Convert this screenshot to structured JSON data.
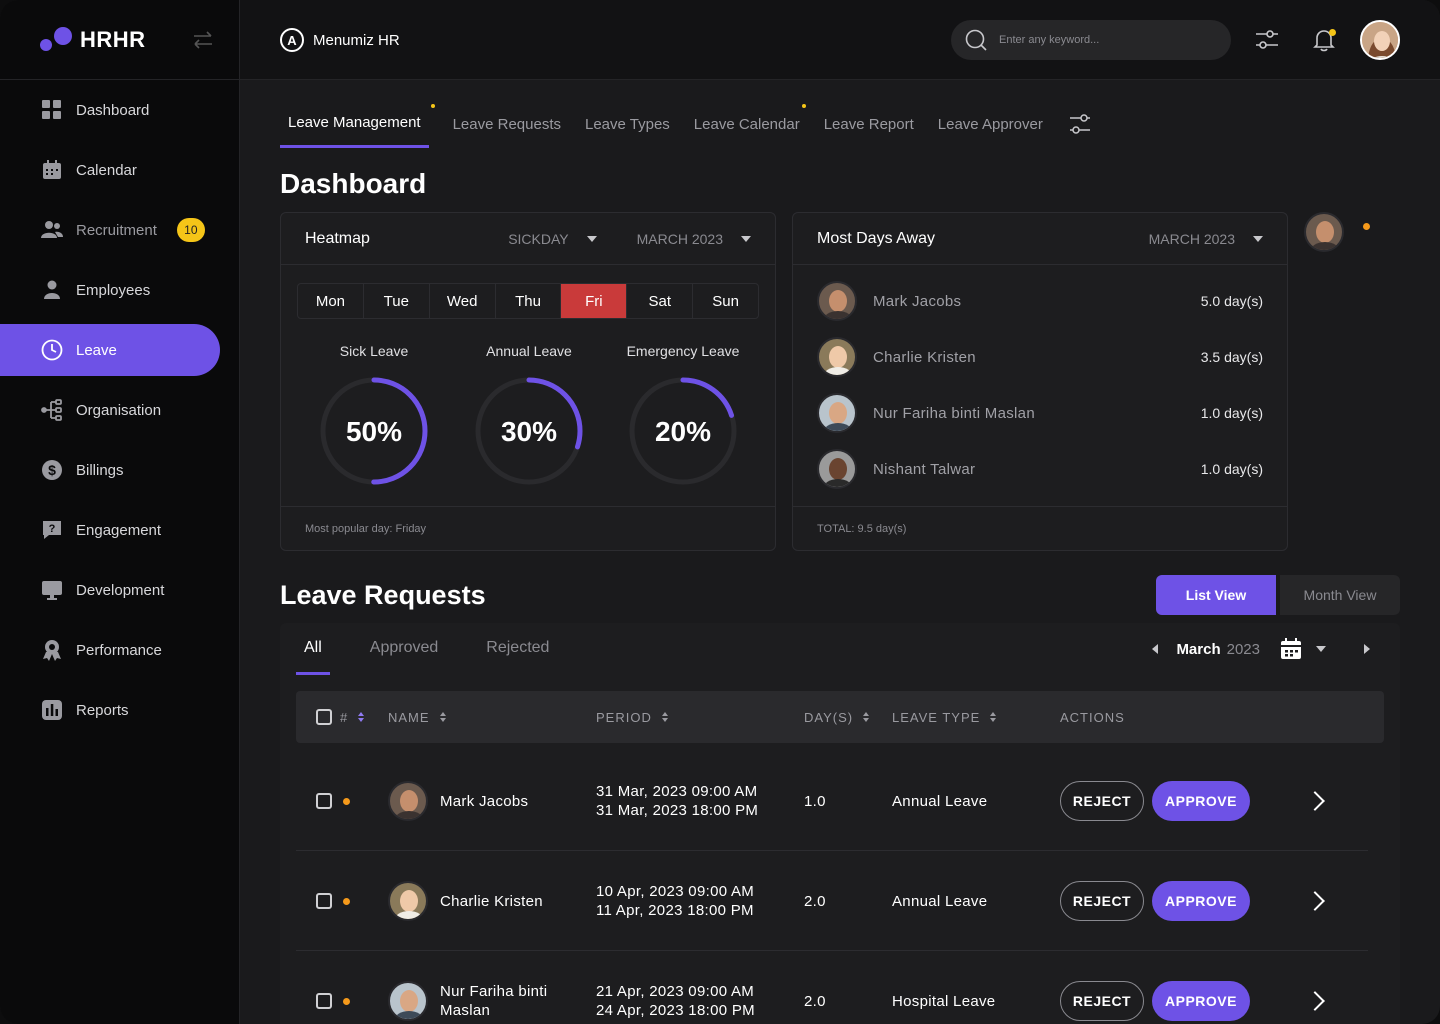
{
  "brand": {
    "name": "HRHR"
  },
  "sidebar": {
    "items": [
      {
        "label": "Dashboard",
        "icon": "grid-icon"
      },
      {
        "label": "Calendar",
        "icon": "calendar-icon"
      },
      {
        "label": "Recruitment",
        "icon": "users-icon",
        "badge": "10"
      },
      {
        "label": "Employees",
        "icon": "user-icon"
      },
      {
        "label": "Leave",
        "icon": "clock-icon",
        "active": true
      },
      {
        "label": "Organisation",
        "icon": "org-icon"
      },
      {
        "label": "Billings",
        "icon": "dollar-icon"
      },
      {
        "label": "Engagement",
        "icon": "chat-icon"
      },
      {
        "label": "Development",
        "icon": "monitor-icon"
      },
      {
        "label": "Performance",
        "icon": "award-icon"
      },
      {
        "label": "Reports",
        "icon": "chart-icon"
      }
    ]
  },
  "topbar": {
    "company_logo": "A",
    "company": "Menumiz HR",
    "search_placeholder": "Enter any keyword..."
  },
  "tabs": [
    {
      "label": "Leave Management",
      "active": true,
      "dot": true
    },
    {
      "label": "Leave Requests"
    },
    {
      "label": "Leave Types"
    },
    {
      "label": "Leave Calendar",
      "dot": true
    },
    {
      "label": "Leave Report"
    },
    {
      "label": "Leave Approver"
    }
  ],
  "page_title": "Dashboard",
  "heatmap": {
    "title": "Heatmap",
    "filter": "SICKDAY",
    "month": "MARCH 2023",
    "days": [
      "Mon",
      "Tue",
      "Wed",
      "Thu",
      "Fri",
      "Sat",
      "Sun"
    ],
    "selected_day": "Fri",
    "donuts": [
      {
        "label": "Sick Leave",
        "percent": 50,
        "text": "50%"
      },
      {
        "label": "Annual Leave",
        "percent": 30,
        "text": "30%"
      },
      {
        "label": "Emergency Leave",
        "percent": 20,
        "text": "20%"
      }
    ],
    "footer": "Most popular day: Friday"
  },
  "most_days_away": {
    "title": "Most Days Away",
    "month": "MARCH 2023",
    "rows": [
      {
        "name": "Mark Jacobs",
        "days": "5.0 day(s)"
      },
      {
        "name": "Charlie Kristen",
        "days": "3.5 day(s)"
      },
      {
        "name": "Nur Fariha binti Maslan",
        "days": "1.0 day(s)"
      },
      {
        "name": "Nishant Talwar",
        "days": "1.0 day(s)"
      }
    ],
    "footer": "TOTAL: 9.5 day(s)"
  },
  "leave_requests": {
    "title": "Leave Requests",
    "view_list": "List View",
    "view_month": "Month View",
    "filters": [
      "All",
      "Approved",
      "Rejected"
    ],
    "month": "March",
    "year": "2023",
    "headers": {
      "num": "#",
      "name": "NAME",
      "period": "PERIOD",
      "days": "DAY(S)",
      "type": "LEAVE TYPE",
      "actions": "ACTIONS"
    },
    "reject_label": "REJECT",
    "approve_label": "APPROVE",
    "rows": [
      {
        "name": "Mark Jacobs",
        "start": "31 Mar, 2023 09:00 AM",
        "end": "31 Mar, 2023 18:00 PM",
        "days": "1.0",
        "type": "Annual Leave"
      },
      {
        "name": "Charlie Kristen",
        "start": "10 Apr, 2023 09:00 AM",
        "end": "11 Apr, 2023 18:00 PM",
        "days": "2.0",
        "type": "Annual Leave"
      },
      {
        "name": "Nur Fariha binti Maslan",
        "start": "21 Apr, 2023 09:00 AM",
        "end": "24 Apr, 2023 18:00 PM",
        "days": "2.0",
        "type": "Hospital Leave"
      }
    ]
  },
  "colors": {
    "accent": "#6e52e6",
    "highlight_day": "#c93a3a",
    "badge": "#f5c518",
    "status_dot": "#f59a1b"
  }
}
